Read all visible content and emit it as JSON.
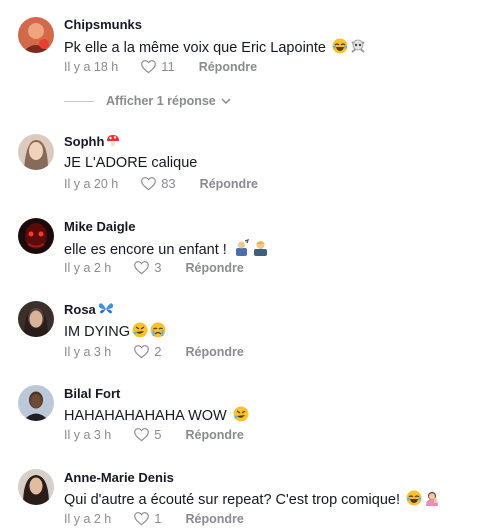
{
  "comments": [
    {
      "username": "Chipsmunks",
      "text": "Pk elle a la même voix que Eric Lapointe",
      "time": "Il y a 18 h",
      "likes": "11",
      "reply": "Répondre"
    },
    {
      "username": "Sophh",
      "text": "JE L'ADORE calique",
      "time": "Il y a 20 h",
      "likes": "83",
      "reply": "Répondre"
    },
    {
      "username": "Mike Daigle",
      "text": "elle es encore un enfant !",
      "time": "Il y a 2 h",
      "likes": "3",
      "reply": "Répondre"
    },
    {
      "username": "Rosa",
      "text": "IM DYING",
      "time": "Il y a 3 h",
      "likes": "2",
      "reply": "Répondre"
    },
    {
      "username": "Bilal Fort",
      "text": "HAHAHAHAHAHA WOW",
      "time": "Il y a 3 h",
      "likes": "5",
      "reply": "Répondre"
    },
    {
      "username": "Anne-Marie Denis",
      "text": "Qui d'autre a écouté sur repeat? C'est trop comique!",
      "time": "Il y a 2 h",
      "likes": "1",
      "reply": "Répondre"
    }
  ],
  "view_replies": "Afficher 1 réponse",
  "colors": {
    "text": "#161823",
    "meta": "#8a8b91"
  },
  "icons": [
    "heart-outline-icon",
    "chevron-down-icon",
    "laughing-emoji-icon",
    "skull-crossbones-icon",
    "mushroom-icon",
    "butterfly-icon",
    "rolling-laughing-icon",
    "crying-face-icon",
    "person-icon"
  ]
}
